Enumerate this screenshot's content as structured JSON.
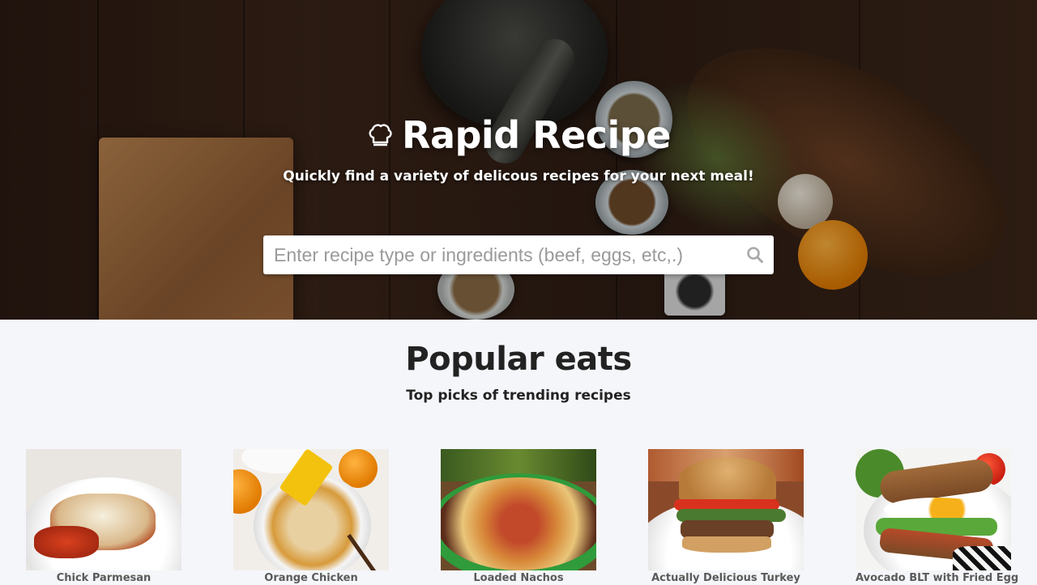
{
  "hero": {
    "title": "Rapid Recipe",
    "tagline": "Quickly find a variety of delicous recipes for your next meal!",
    "logo_icon": "chef-hat-icon"
  },
  "search": {
    "placeholder": "Enter recipe type or ingredients (beef, eggs, etc,.)",
    "value": "",
    "icon": "search-icon"
  },
  "popular": {
    "title": "Popular eats",
    "subtitle": "Top picks of trending recipes",
    "recipes": [
      {
        "name": "Chick Parmesan"
      },
      {
        "name": "Orange Chicken"
      },
      {
        "name": "Loaded Nachos"
      },
      {
        "name": "Actually Delicious Turkey"
      },
      {
        "name": "Avocado BLT with Fried Egg"
      }
    ]
  },
  "colors": {
    "page_background": "#f5f6fa",
    "hero_text": "#ffffff",
    "heading_text": "#222222",
    "recipe_label": "#5a5a5a"
  }
}
